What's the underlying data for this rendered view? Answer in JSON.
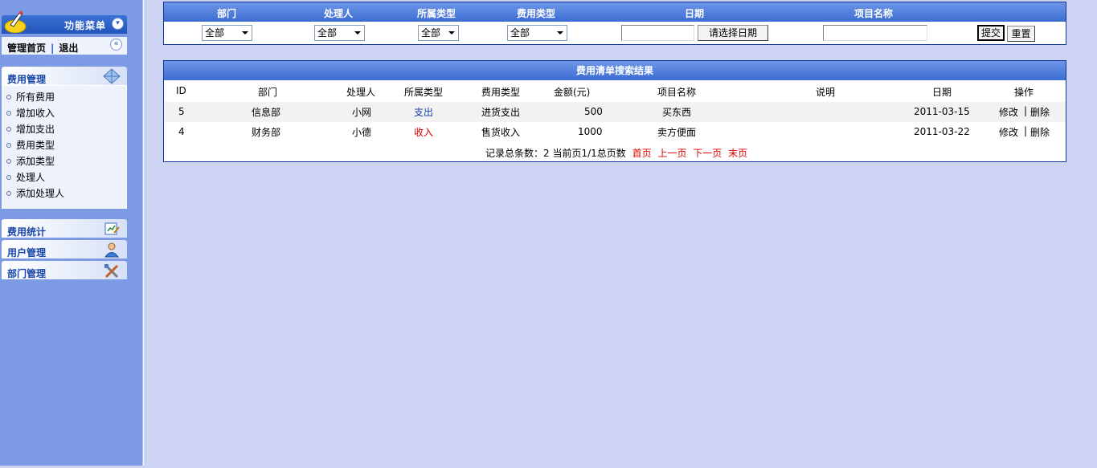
{
  "sidebar": {
    "menu_title": "功能菜单",
    "admin": {
      "home": "管理首页",
      "separator": "|",
      "logout": "退出"
    },
    "groups": [
      {
        "label": "费用管理",
        "items": [
          "所有费用",
          "增加收入",
          "增加支出",
          "费用类型",
          "添加类型",
          "处理人",
          "添加处理人"
        ]
      },
      {
        "label": "费用统计"
      },
      {
        "label": "用户管理"
      },
      {
        "label": "部门管理"
      }
    ]
  },
  "search": {
    "headers": {
      "department": "部门",
      "handler": "处理人",
      "category": "所属类型",
      "fee_type": "费用类型",
      "date": "日期",
      "project": "项目名称"
    },
    "department_value": "全部",
    "handler_value": "全部",
    "category_value": "全部",
    "fee_type_value": "全部",
    "date_button": "请选择日期",
    "submit": "提交",
    "reset": "重置"
  },
  "results": {
    "title": "费用清单搜索结果",
    "columns": [
      "ID",
      "部门",
      "处理人",
      "所属类型",
      "费用类型",
      "金额(元)",
      "项目名称",
      "说明",
      "日期",
      "操作"
    ],
    "rows": [
      {
        "id": "5",
        "dept": "信息部",
        "handler": "小网",
        "category": "支出",
        "fee_type": "进货支出",
        "amount": "500",
        "project": "买东西",
        "note": "",
        "date": "2011-03-15",
        "edit": "修改",
        "sep": "|",
        "del": "删除"
      },
      {
        "id": "4",
        "dept": "财务部",
        "handler": "小德",
        "category": "收入",
        "fee_type": "售货收入",
        "amount": "1000",
        "project": "卖方便面",
        "note": "",
        "date": "2011-03-22",
        "edit": "修改",
        "sep": "|",
        "del": "删除"
      }
    ],
    "pager": {
      "summary": "记录总条数：2 当前页1/1总页数",
      "first": "首页",
      "prev": "上一页",
      "next": "下一页",
      "last": "末页"
    }
  },
  "colors": {
    "income": "#e00000",
    "expense": "#1a3faa",
    "header_blue": "#3b6cd2"
  }
}
